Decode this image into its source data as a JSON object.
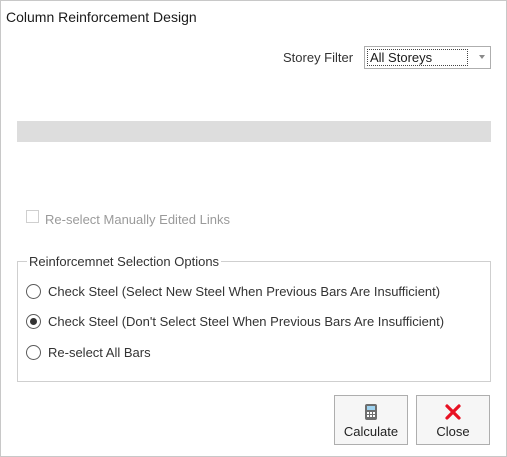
{
  "window": {
    "title": "Column Reinforcement Design"
  },
  "storey_filter": {
    "label": "Storey Filter",
    "selected": "All Storeys"
  },
  "progress": {
    "value": 0
  },
  "reselect_links": {
    "label": "Re-select Manually Edited Links",
    "checked": false,
    "enabled": false
  },
  "options_group": {
    "title": "Reinforcemnet Selection Options",
    "options": [
      {
        "label": "Check Steel (Select New Steel When Previous Bars Are Insufficient)",
        "checked": false
      },
      {
        "label": "Check Steel (Don't Select Steel When Previous Bars Are Insufficient)",
        "checked": true
      },
      {
        "label": "Re-select All Bars",
        "checked": false
      }
    ]
  },
  "buttons": {
    "calculate": {
      "label": "Calculate",
      "icon": "calculator-icon"
    },
    "close": {
      "label": "Close",
      "icon": "close-icon",
      "icon_color": "#e81123"
    }
  }
}
